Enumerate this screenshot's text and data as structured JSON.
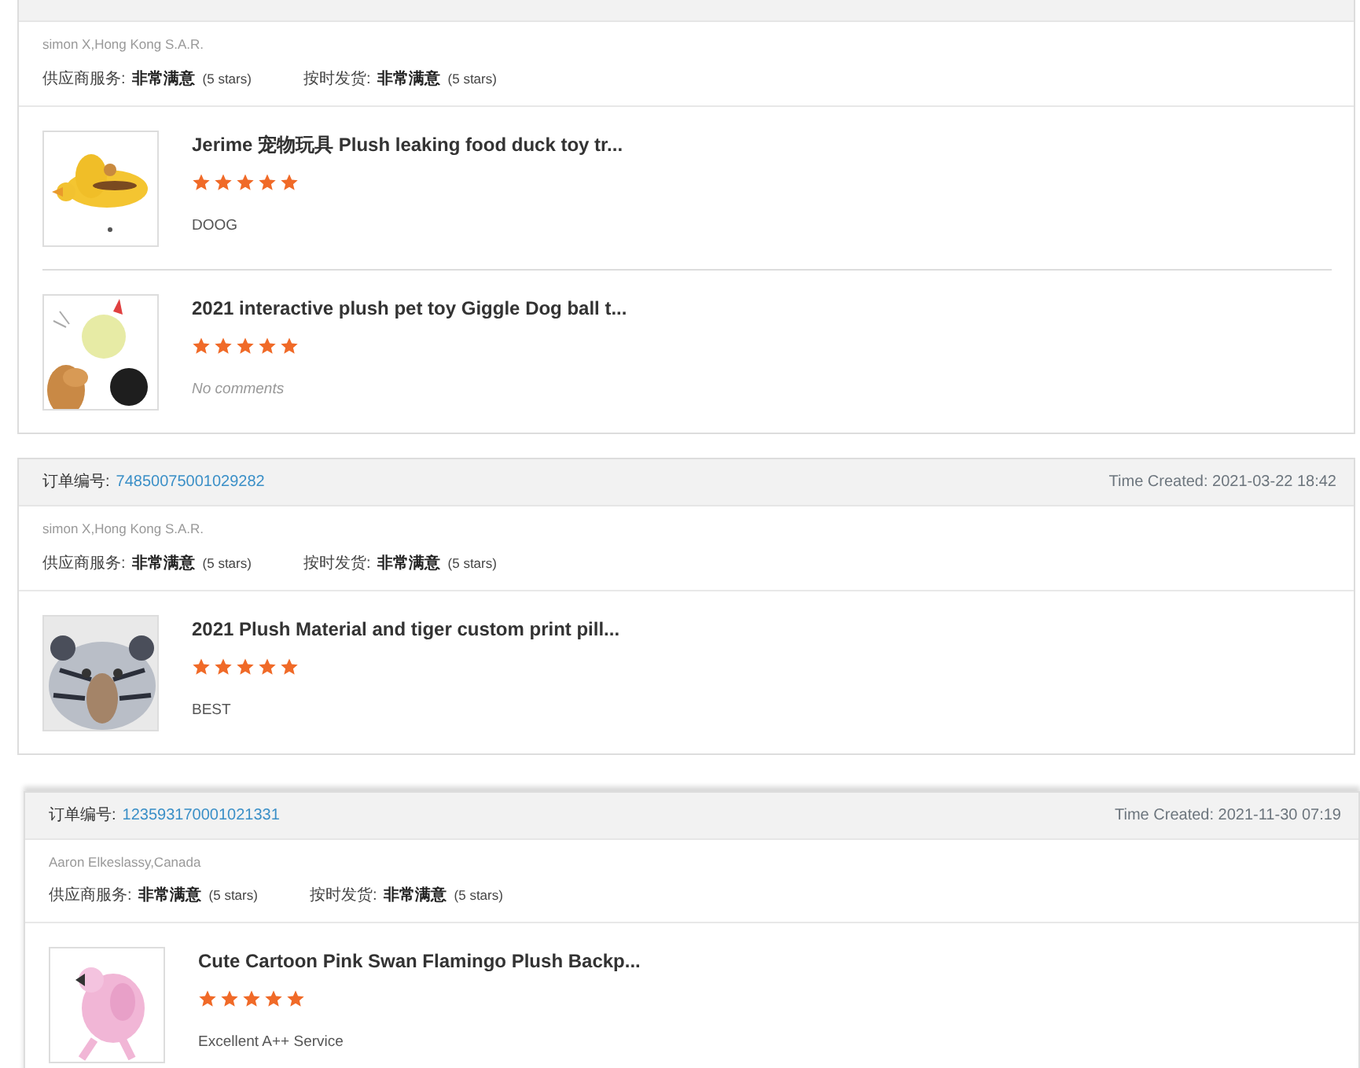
{
  "orders": [
    {
      "customer": "simon X,Hong Kong S.A.R.",
      "ratings": [
        {
          "label": "供应商服务:",
          "value": "非常满意",
          "stars_text": "(5 stars)"
        },
        {
          "label": "按时发货:",
          "value": "非常满意",
          "stars_text": "(5 stars)"
        }
      ],
      "items": [
        {
          "title": "Jerime 宠物玩具 Plush leaking food duck toy tr...",
          "stars": 5,
          "comment": "DOOG",
          "kind": "text"
        },
        {
          "title": "2021 interactive plush pet toy Giggle Dog ball t...",
          "stars": 5,
          "comment": "No comments",
          "kind": "empty"
        }
      ]
    },
    {
      "order_label": "订单编号:",
      "order_number": "74850075001029282",
      "time_created": "Time Created: 2021-03-22 18:42",
      "customer": "simon X,Hong Kong S.A.R.",
      "ratings": [
        {
          "label": "供应商服务:",
          "value": "非常满意",
          "stars_text": "(5 stars)"
        },
        {
          "label": "按时发货:",
          "value": "非常满意",
          "stars_text": "(5 stars)"
        }
      ],
      "items": [
        {
          "title": "2021 Plush Material and tiger custom print pill...",
          "stars": 5,
          "comment": "BEST",
          "kind": "text"
        }
      ]
    },
    {
      "order_label": "订单编号:",
      "order_number": "123593170001021331",
      "time_created": "Time Created: 2021-11-30 07:19",
      "customer": "Aaron Elkeslassy,Canada",
      "ratings": [
        {
          "label": "供应商服务:",
          "value": "非常满意",
          "stars_text": "(5 stars)"
        },
        {
          "label": "按时发货:",
          "value": "非常满意",
          "stars_text": "(5 stars)"
        }
      ],
      "items": [
        {
          "title": "Cute Cartoon Pink Swan Flamingo Plush Backp...",
          "stars": 5,
          "comment": "Excellent A++ Service",
          "kind": "text"
        }
      ]
    }
  ]
}
